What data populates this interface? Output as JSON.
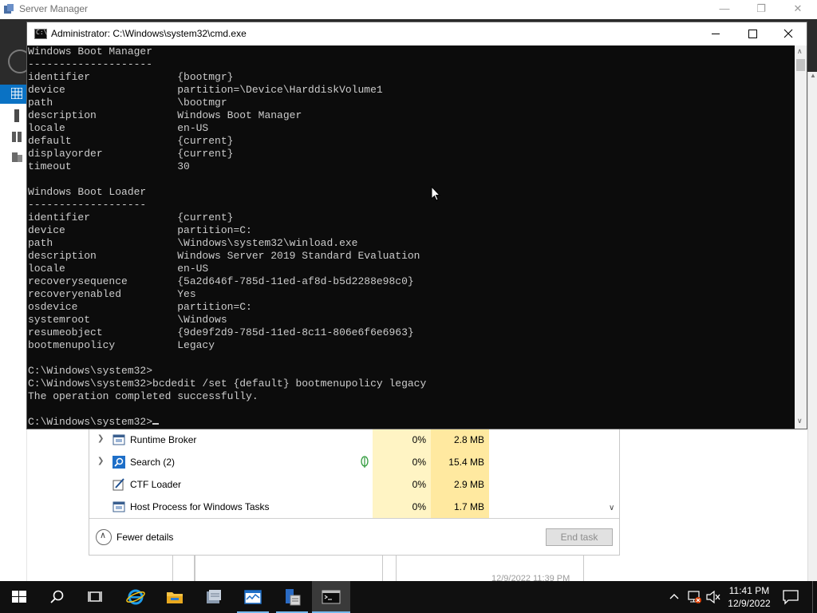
{
  "server_manager": {
    "title": "Server Manager",
    "bottom_timestamp": "12/9/2022 11:39 PM"
  },
  "cmd": {
    "title": "Administrator: C:\\Windows\\system32\\cmd.exe",
    "lines": [
      "Windows Boot Manager",
      "--------------------",
      "identifier              {bootmgr}",
      "device                  partition=\\Device\\HarddiskVolume1",
      "path                    \\bootmgr",
      "description             Windows Boot Manager",
      "locale                  en-US",
      "default                 {current}",
      "displayorder            {current}",
      "timeout                 30",
      "",
      "Windows Boot Loader",
      "-------------------",
      "identifier              {current}",
      "device                  partition=C:",
      "path                    \\Windows\\system32\\winload.exe",
      "description             Windows Server 2019 Standard Evaluation",
      "locale                  en-US",
      "recoverysequence        {5a2d646f-785d-11ed-af8d-b5d2288e98c0}",
      "recoveryenabled         Yes",
      "osdevice                partition=C:",
      "systemroot              \\Windows",
      "resumeobject            {9de9f2d9-785d-11ed-8c11-806e6f6e6963}",
      "bootmenupolicy          Legacy",
      "",
      "C:\\Windows\\system32>",
      "C:\\Windows\\system32>bcdedit /set {default} bootmenupolicy legacy",
      "The operation completed successfully.",
      "",
      "C:\\Windows\\system32>"
    ]
  },
  "task_manager": {
    "rows": [
      {
        "name": "Runtime Broker",
        "cpu": "0%",
        "memory": "2.8 MB",
        "expandable": true,
        "icon": "app-window-icon",
        "leaf": false
      },
      {
        "name": "Search (2)",
        "cpu": "0%",
        "memory": "15.4 MB",
        "expandable": true,
        "icon": "search-icon",
        "leaf": true
      },
      {
        "name": "CTF Loader",
        "cpu": "0%",
        "memory": "2.9 MB",
        "expandable": false,
        "icon": "pen-icon",
        "leaf": false
      },
      {
        "name": "Host Process for Windows Tasks",
        "cpu": "0%",
        "memory": "1.7 MB",
        "expandable": false,
        "icon": "app-window-icon",
        "leaf": false
      }
    ],
    "fewer_details": "Fewer details",
    "end_task": "End task"
  },
  "taskbar": {
    "apps": [
      "start-icon",
      "search-icon",
      "task-view-icon",
      "internet-explorer-icon",
      "file-explorer-icon",
      "server-manager-icon",
      "task-manager-icon",
      "file-server-icon",
      "cmd-icon"
    ],
    "active": "cmd-icon",
    "clock_time": "11:41 PM",
    "clock_date": "12/9/2022"
  },
  "colors": {
    "accent": "#0a72c4",
    "console_bg": "#0c0c0c",
    "console_fg": "#cccccc",
    "taskbar_bg": "#101010",
    "cpu_heat": "#fff4c4",
    "mem_heat": "#ffe9a0"
  }
}
